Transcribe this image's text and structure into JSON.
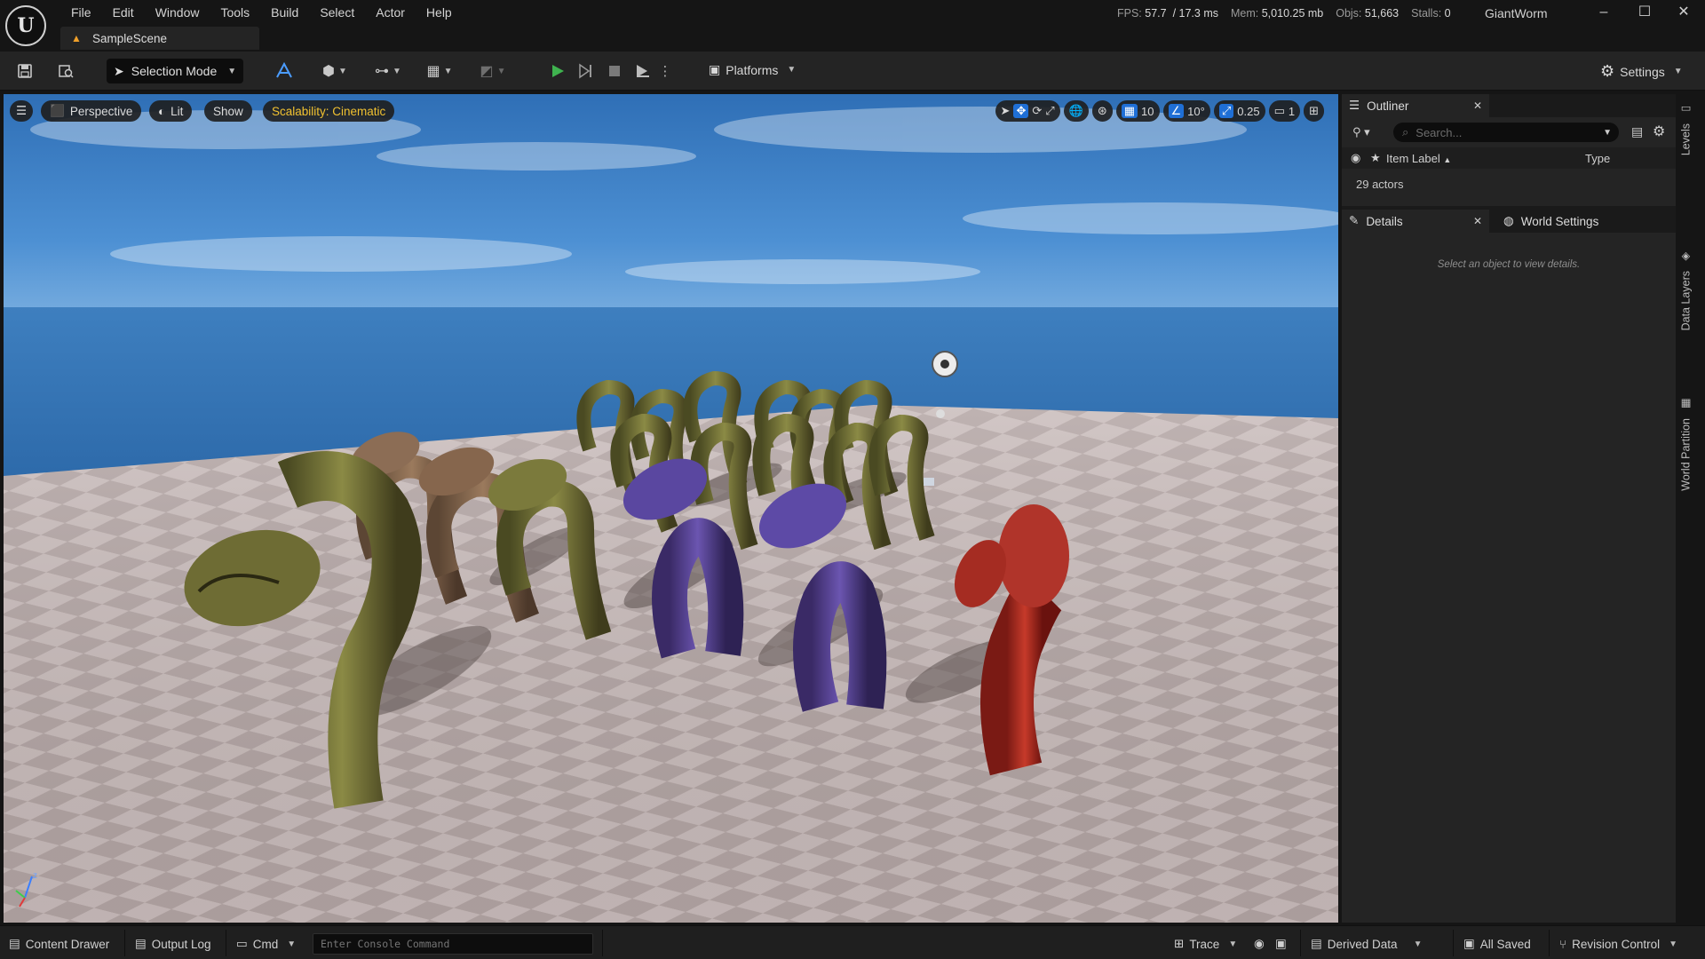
{
  "menu": {
    "items": [
      "File",
      "Edit",
      "Window",
      "Tools",
      "Build",
      "Select",
      "Actor",
      "Help"
    ]
  },
  "logo_text": "U",
  "tab": {
    "label": "SampleScene"
  },
  "stats": {
    "fps_label": "FPS:",
    "fps": "57.7",
    "ms": "/ 17.3 ms",
    "mem_label": "Mem:",
    "mem": "5,010.25 mb",
    "objs_label": "Objs:",
    "objs": "51,663",
    "stalls_label": "Stalls:",
    "stalls": "0"
  },
  "project_name": "GiantWorm",
  "window_controls": {
    "minimize": "–",
    "maximize": "☐",
    "close": "✕"
  },
  "toolbar": {
    "selection_mode": "Selection Mode",
    "platforms": "Platforms",
    "settings": "Settings"
  },
  "viewport": {
    "perspective": "Perspective",
    "lit": "Lit",
    "show": "Show",
    "scalability": "Scalability: Cinematic",
    "grid_snap": "10",
    "rot_snap": "10°",
    "scale_snap": "0.25",
    "camera_speed": "1"
  },
  "outliner": {
    "title": "Outliner",
    "search_placeholder": "Search...",
    "col_label": "Item Label",
    "col_type": "Type",
    "actor_count": "29 actors"
  },
  "details": {
    "title": "Details",
    "world_settings": "World Settings",
    "empty_message": "Select an object to view details."
  },
  "side_tabs": {
    "levels": "Levels",
    "data_layers": "Data Layers",
    "world_partition": "World Partition"
  },
  "statusbar": {
    "content_drawer": "Content Drawer",
    "output_log": "Output Log",
    "cmd": "Cmd",
    "console_placeholder": "Enter Console Command",
    "trace": "Trace",
    "derived_data": "Derived Data",
    "all_saved": "All Saved",
    "revision_control": "Revision Control"
  },
  "colors": {
    "accent": "#1f6fd6",
    "play": "#3fb34f",
    "scalability": "#f2c230",
    "warning": "#f0a02a"
  }
}
